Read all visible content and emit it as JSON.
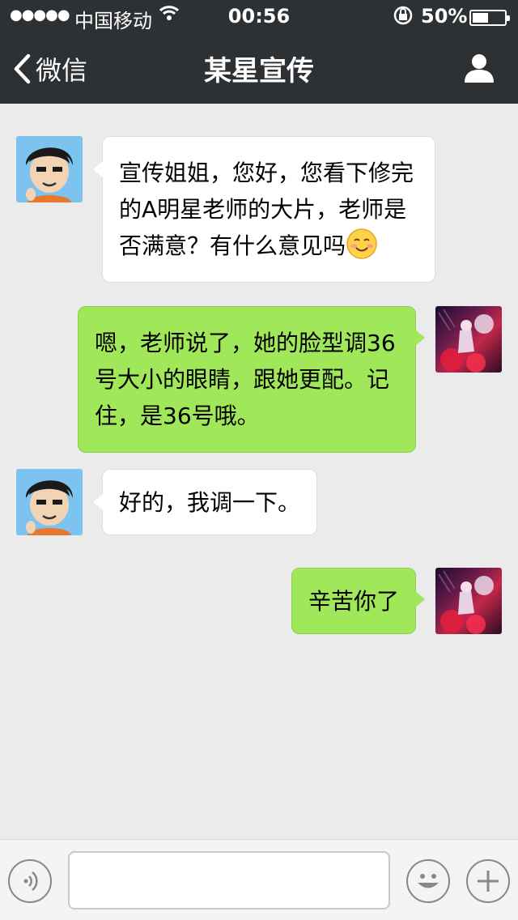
{
  "status_bar": {
    "signal_dots": "●●●●●",
    "carrier": "中国移动",
    "time": "00:56",
    "battery_percent": "50%",
    "battery_level": 0.5
  },
  "nav": {
    "back_label": "微信",
    "title": "某星宣传",
    "back_icon": "chevron-left-icon",
    "profile_icon": "person-icon"
  },
  "messages": [
    {
      "direction": "incoming",
      "text": "宣传姐姐，您好，您看下修完的A明星老师的大片，老师是否满意？有什么意见吗",
      "emoji": "smile-emoji-icon"
    },
    {
      "direction": "outgoing",
      "text": "嗯，老师说了，她的脸型调36号大小的眼睛，跟她更配。记住，是36号哦。"
    },
    {
      "direction": "incoming",
      "text": "好的，我调一下。"
    },
    {
      "direction": "outgoing",
      "text": "辛苦你了"
    }
  ],
  "input_bar": {
    "message_value": "",
    "voice_icon": "voice-icon",
    "emoji_icon": "emoji-icon",
    "plus_icon": "plus-icon"
  },
  "colors": {
    "header_bg": "#2e3134",
    "chat_bg": "#ebebeb",
    "outgoing_bubble": "#a0e75a",
    "incoming_bubble": "#ffffff"
  }
}
